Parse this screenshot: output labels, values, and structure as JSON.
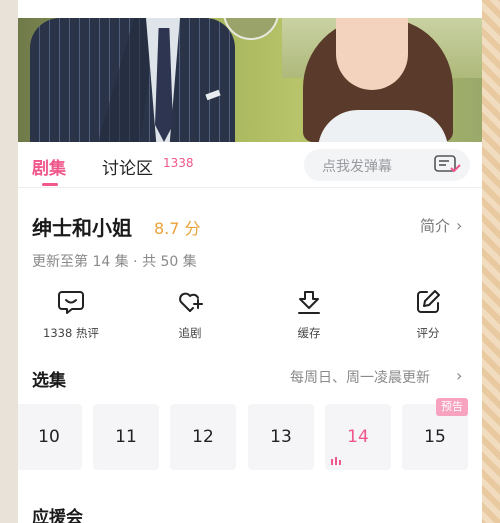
{
  "tabs": {
    "episodes": "剧集",
    "discussion": "讨论区",
    "discussion_count": "1338",
    "danmaku_placeholder": "点我发弹幕"
  },
  "show": {
    "title": "绅士和小姐",
    "score": "8.7 分",
    "intro_label": "简介",
    "update_status": "更新至第 14 集 · 共 50 集"
  },
  "actions": [
    {
      "label": "1338 热评",
      "icon": "comment-icon"
    },
    {
      "label": "追剧",
      "icon": "heart-plus-icon"
    },
    {
      "label": "缓存",
      "icon": "download-icon"
    },
    {
      "label": "评分",
      "icon": "edit-icon"
    }
  ],
  "episodes_section": {
    "title": "选集",
    "schedule": "每周日、周一凌晨更新",
    "items": [
      {
        "number": "10"
      },
      {
        "number": "11"
      },
      {
        "number": "12"
      },
      {
        "number": "13"
      },
      {
        "number": "14",
        "active": true
      },
      {
        "number": "15",
        "badge": "预告"
      }
    ]
  },
  "support_section": {
    "title": "应援会"
  },
  "colors": {
    "accent": "#f0578a",
    "score": "#e9a33a",
    "badge": "#f7a2bf"
  }
}
